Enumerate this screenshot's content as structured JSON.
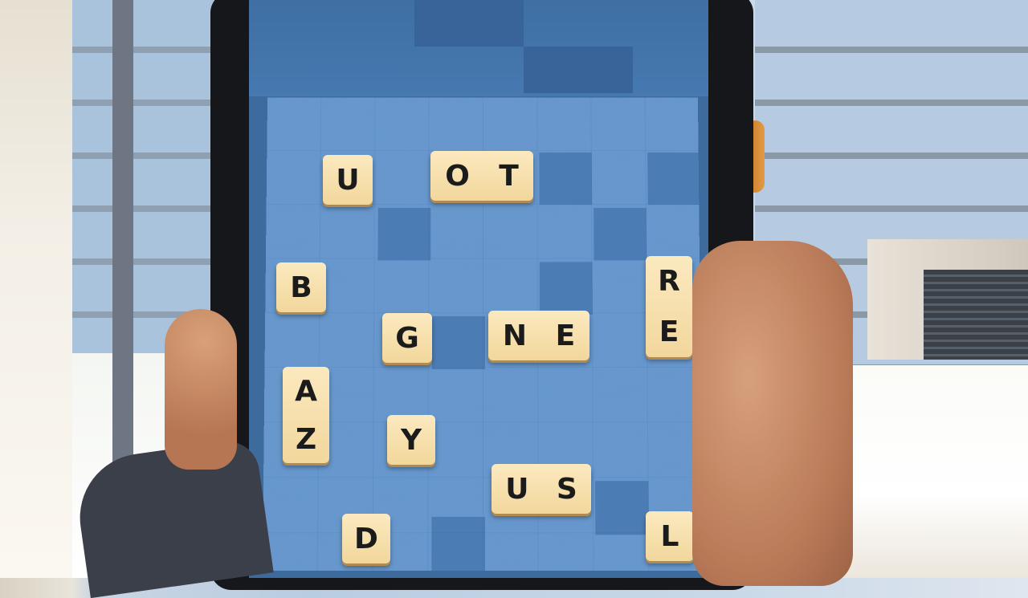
{
  "game": {
    "board_tiles": [
      {
        "id": "U",
        "letters": [
          "U"
        ],
        "orientation": "h"
      },
      {
        "id": "OT",
        "letters": [
          "O",
          "T"
        ],
        "orientation": "h"
      },
      {
        "id": "B",
        "letters": [
          "B"
        ],
        "orientation": "h"
      },
      {
        "id": "RE",
        "letters": [
          "R",
          "E"
        ],
        "orientation": "v"
      },
      {
        "id": "G",
        "letters": [
          "G"
        ],
        "orientation": "h"
      },
      {
        "id": "NE",
        "letters": [
          "N",
          "E"
        ],
        "orientation": "h"
      },
      {
        "id": "AZ",
        "letters": [
          "A",
          "Z"
        ],
        "orientation": "v"
      },
      {
        "id": "Y",
        "letters": [
          "Y"
        ],
        "orientation": "h"
      },
      {
        "id": "US",
        "letters": [
          "U",
          "S"
        ],
        "orientation": "h"
      },
      {
        "id": "D",
        "letters": [
          "D"
        ],
        "orientation": "h"
      },
      {
        "id": "L",
        "letters": [
          "L"
        ],
        "orientation": "h"
      }
    ]
  },
  "colors": {
    "board": "#5a8ec8",
    "tile_face": "#f2d79c",
    "tile_text": "#1b1b1b"
  }
}
